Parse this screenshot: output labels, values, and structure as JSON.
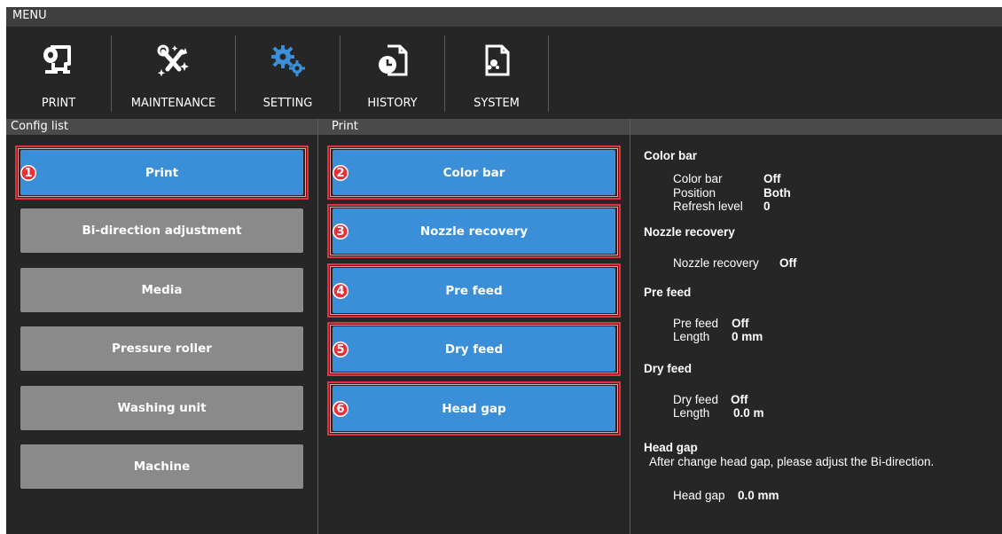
{
  "menu": {
    "title": "MENU"
  },
  "toolbar": {
    "items": [
      {
        "label": "PRINT",
        "icon": "print-roll-icon"
      },
      {
        "label": "MAINTENANCE",
        "icon": "tools-icon"
      },
      {
        "label": "SETTING",
        "icon": "gears-icon",
        "active": true
      },
      {
        "label": "HISTORY",
        "icon": "history-clock-icon"
      },
      {
        "label": "SYSTEM",
        "icon": "system-doc-icon"
      }
    ]
  },
  "config_list": {
    "header": "Config list",
    "items": [
      {
        "label": "Print",
        "selected": true,
        "badge": "1"
      },
      {
        "label": "Bi-direction adjustment"
      },
      {
        "label": "Media"
      },
      {
        "label": "Pressure roller"
      },
      {
        "label": "Washing unit"
      },
      {
        "label": "Machine"
      }
    ]
  },
  "print_panel": {
    "header": "Print",
    "items": [
      {
        "label": "Color bar",
        "badge": "2"
      },
      {
        "label": "Nozzle recovery",
        "badge": "3"
      },
      {
        "label": "Pre feed",
        "badge": "4"
      },
      {
        "label": "Dry feed",
        "badge": "5"
      },
      {
        "label": "Head gap",
        "badge": "6"
      }
    ]
  },
  "details": {
    "color_bar": {
      "title": "Color bar",
      "rows": [
        {
          "label": "Color bar",
          "value": "Off"
        },
        {
          "label": "Position",
          "value": "Both"
        },
        {
          "label": "Refresh level",
          "value": "0"
        }
      ]
    },
    "nozzle_recovery": {
      "title": "Nozzle recovery",
      "rows": [
        {
          "label": "Nozzle recovery",
          "value": "Off"
        }
      ]
    },
    "pre_feed": {
      "title": "Pre feed",
      "rows": [
        {
          "label": "Pre feed",
          "value": "Off"
        },
        {
          "label": "Length",
          "value": "0 mm"
        }
      ]
    },
    "dry_feed": {
      "title": "Dry feed",
      "rows": [
        {
          "label": "Dry feed",
          "value": "Off"
        },
        {
          "label": "Length",
          "value": "0.0 m"
        }
      ]
    },
    "head_gap": {
      "title": "Head gap",
      "note": "After change head gap, please adjust the Bi-direction.",
      "rows": [
        {
          "label": "Head gap",
          "value": "0.0 mm"
        }
      ]
    }
  },
  "colors": {
    "background": "#262626",
    "button_blue": "#3a8fd8",
    "button_gray": "#8a8a8a",
    "highlight_red": "#e8303a",
    "setting_icon_blue": "#3a8fd8"
  }
}
